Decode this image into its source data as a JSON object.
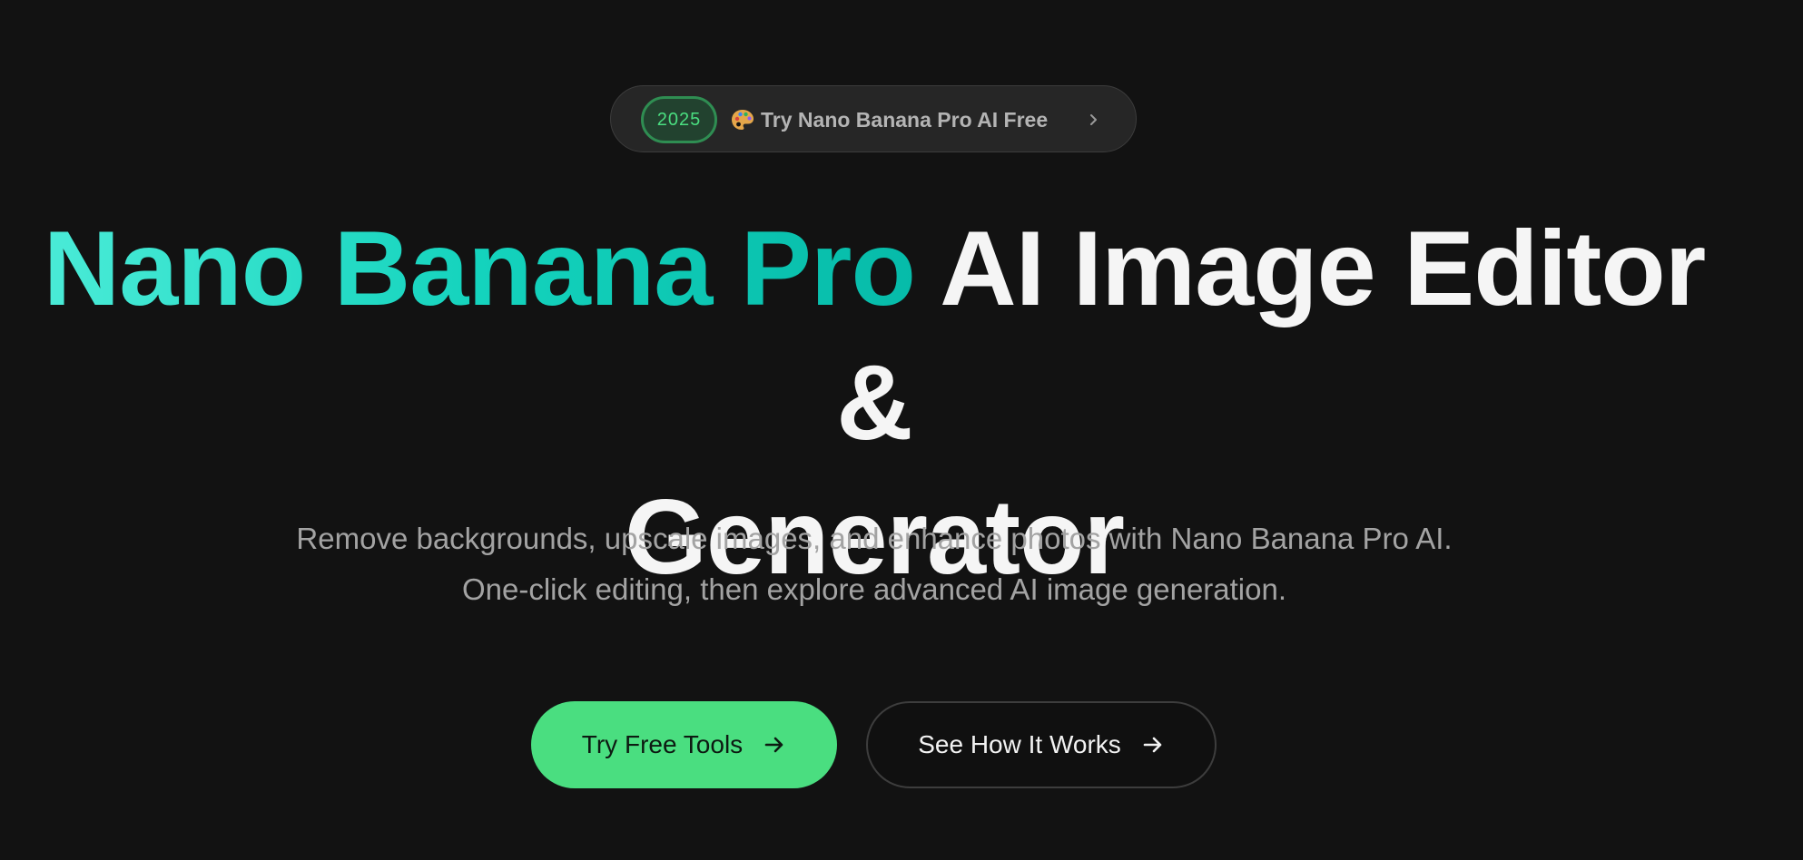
{
  "announcement": {
    "year_badge": "2025",
    "text": "Try Nano Banana Pro AI Free",
    "leading_icon": "palette-icon",
    "trailing_icon": "chevron-right-icon"
  },
  "hero": {
    "title_accent": "Nano Banana Pro",
    "title_line1_rest": " AI Image Editor &",
    "title_line2": "Generator",
    "subtitle": "Remove backgrounds, upscale images, and enhance photos with Nano Banana Pro AI. One-click editing, then explore advanced AI image generation."
  },
  "cta": {
    "primary_label": "Try Free Tools",
    "secondary_label": "See How It Works",
    "arrow_icon": "arrow-right-icon"
  },
  "colors": {
    "background": "#121212",
    "accent_green": "#4ade80",
    "title_gradient_start": "#4aebd7",
    "title_gradient_end": "#06bba9",
    "text_primary": "#f5f5f5",
    "text_muted": "#a3a3a3"
  }
}
